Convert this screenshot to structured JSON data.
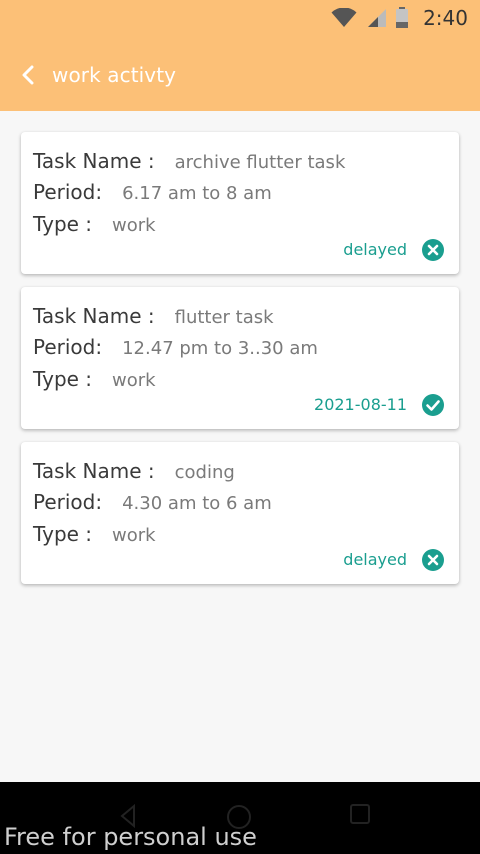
{
  "statusbar": {
    "time": "2:40",
    "icons": [
      "wifi-icon",
      "signal-icon",
      "battery-icon"
    ]
  },
  "appbar": {
    "title": "work activty",
    "back_icon": "back-arrow-icon",
    "background": "#fcc077"
  },
  "tasks": [
    {
      "task_name_label": "Task Name :",
      "task_name": "archive flutter task",
      "period_label": "Period:",
      "period": "6.17 am to 8 am",
      "type_label": "Type :",
      "type": "work",
      "status": "delayed",
      "status_icon": "cancel-circle-icon"
    },
    {
      "task_name_label": "Task Name :",
      "task_name": "flutter task",
      "period_label": "Period:",
      "period": "12.47 pm to 3..30 am",
      "type_label": "Type :",
      "type": "work",
      "status": "2021-08-11",
      "status_icon": "check-circle-icon"
    },
    {
      "task_name_label": "Task Name :",
      "task_name": "coding",
      "period_label": "Period:",
      "period": "4.30 am to 6 am",
      "type_label": "Type :",
      "type": "work",
      "status": "delayed",
      "status_icon": "cancel-circle-icon"
    }
  ],
  "colors": {
    "accent": "#1a9e8f",
    "header": "#fcc077",
    "background": "#f7f7f7"
  },
  "navbar": {
    "buttons": [
      "back-nav-icon",
      "home-nav-icon",
      "recents-nav-icon"
    ]
  },
  "watermark": "Free for personal use"
}
